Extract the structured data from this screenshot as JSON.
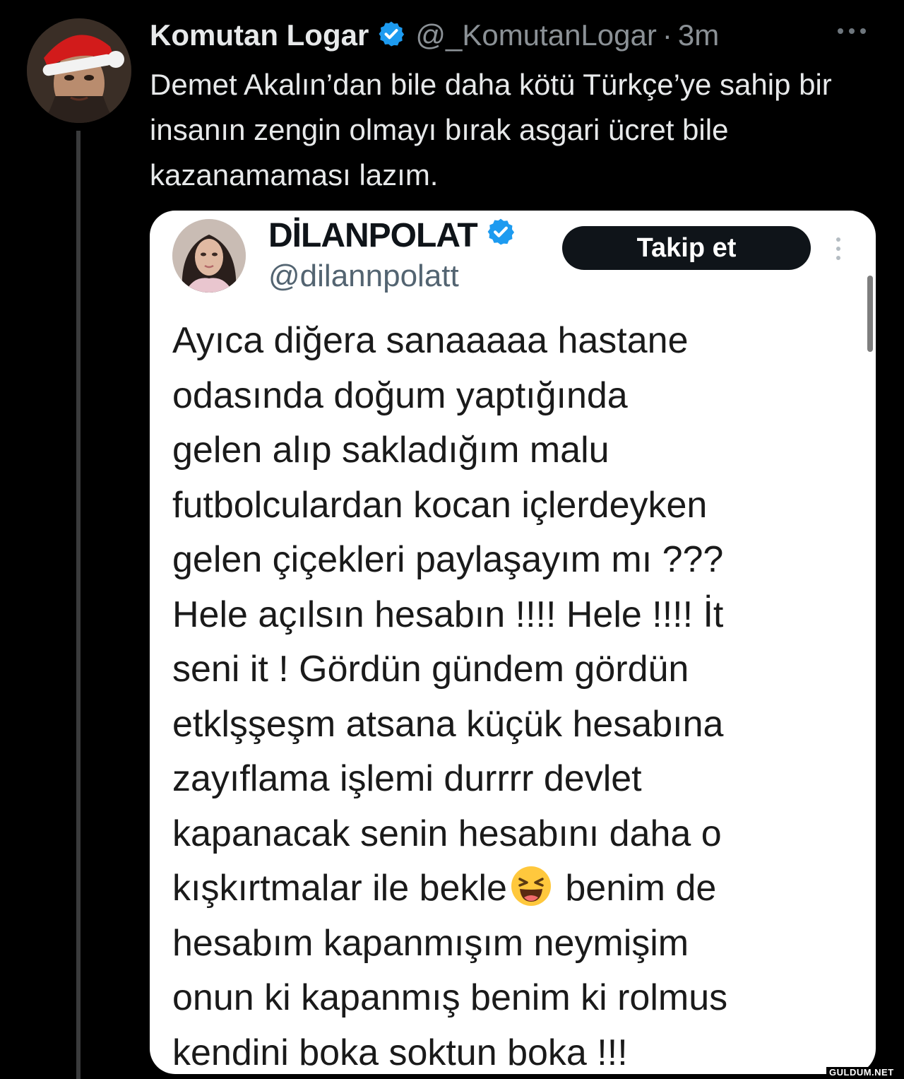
{
  "tweet": {
    "author_name": "Komutan Logar",
    "handle": "@_KomutanLogar",
    "separator": "·",
    "time": "3m",
    "text": "Demet Akalın’dan bile daha kötü Türkçe’ye sahip bir insanın zengin olmayı bırak asgari ücret bile kazanamaması lazım."
  },
  "quoted_tweet": {
    "author_name": "DİLANPOLAT",
    "handle": "@dilannpolatt",
    "follow_label": "Takip et",
    "text_before_emoji": "Ayıca diğera sanaaaaa  hastane\nodasında doğum yaptığında\ngelen alıp sakladığım malu\nfutbolculardan kocan içlerdeyken\ngelen çiçekleri paylaşayım mı ???\nHele açılsın hesabın !!!! Hele !!!! İt\nseni it ! Gördün gündem gördün\netklşşeşm atsana küçük hesabına\nzayıflama işlemi durrrr devlet\nkapanacak senin hesabını daha o\nkışkırtmalar ile bekle",
    "text_after_emoji": " benim de\nhesabım kapanmışım neymişim\nonun ki kapanmış benim ki rolmus\nkendini boka soktun boka !!!"
  },
  "watermark": "GULDUM.NET",
  "colors": {
    "background": "#000000",
    "verified_blue": "#1d9bf0",
    "follow_button": "#0f1419"
  }
}
